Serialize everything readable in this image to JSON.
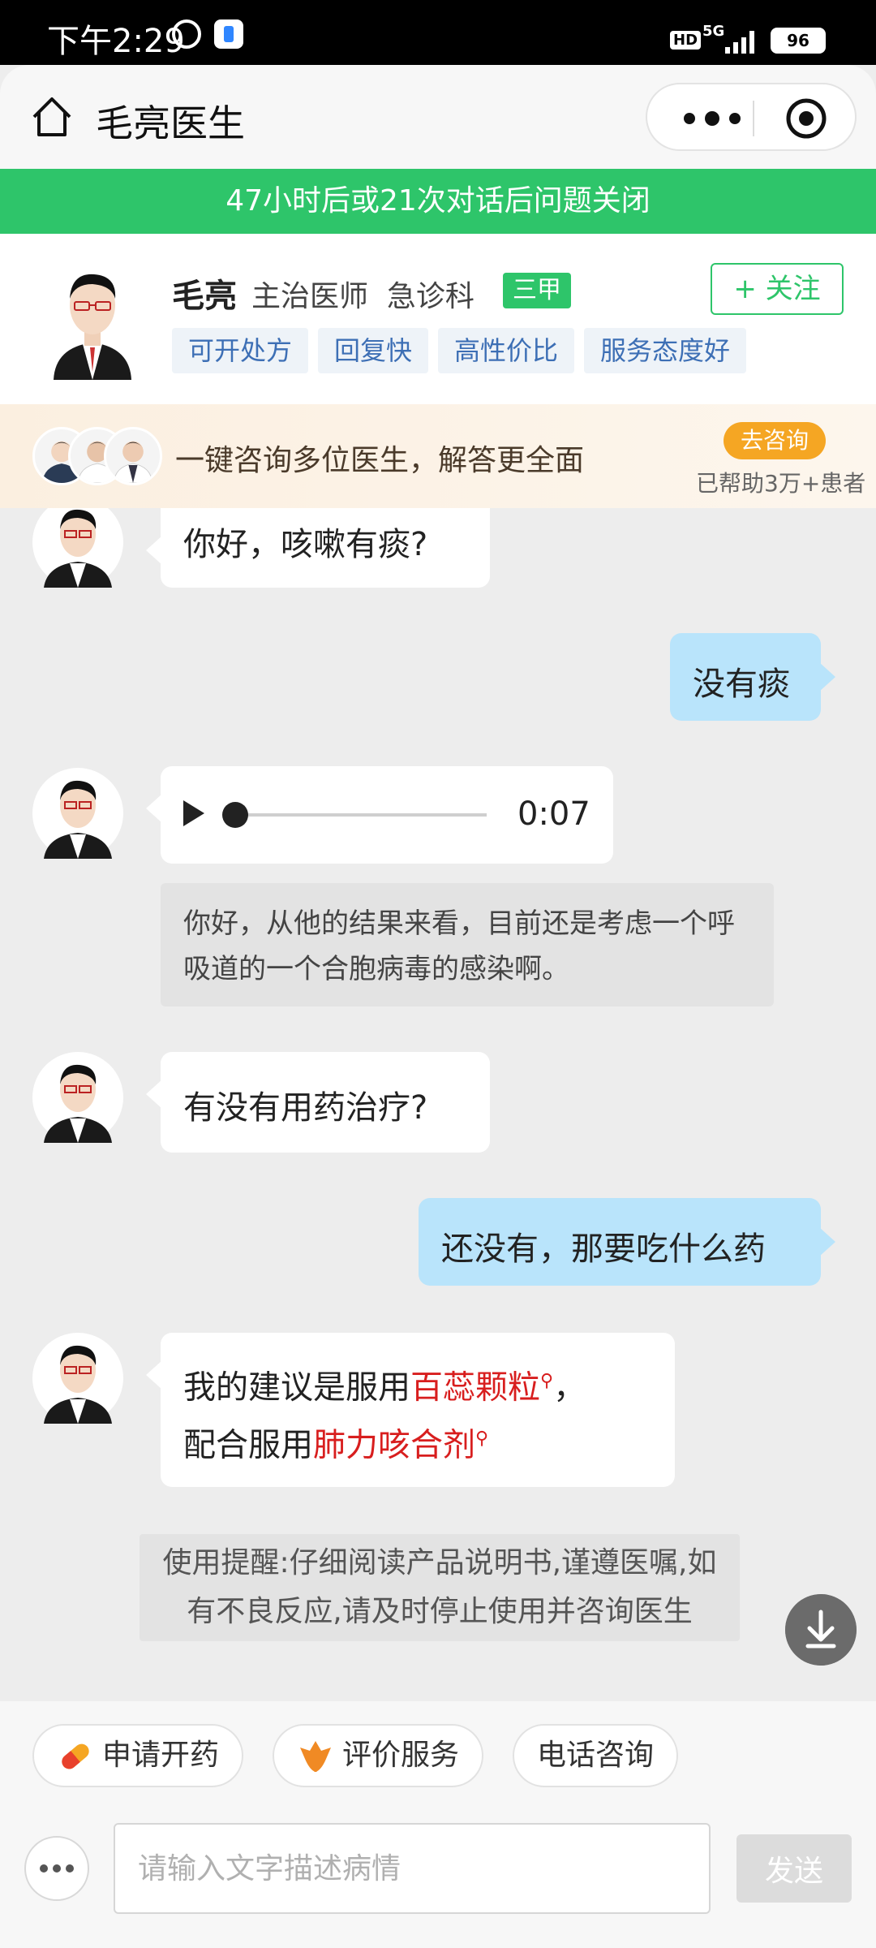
{
  "status_bar": {
    "time": "下午2:29",
    "hd": "HD",
    "network": "5G",
    "battery": "96"
  },
  "header": {
    "title": "毛亮医生"
  },
  "banner": {
    "text": "47小时后或21次对话后问题关闭"
  },
  "doctor": {
    "name": "毛亮",
    "info": "主治医师  急诊科",
    "hospital_badge": "三甲",
    "follow_label": "+ 关注",
    "tags": [
      "可开处方",
      "回复快",
      "高性价比",
      "服务态度好"
    ]
  },
  "consult_banner": {
    "text": "一键咨询多位医生，解答更全面",
    "button": "去咨询",
    "helped": "已帮助3万+患者"
  },
  "messages": {
    "m1": "你好，咳嗽有痰?",
    "m2": "没有痰",
    "voice_duration": "0:07",
    "voice_transcript": "你好，从他的结果来看，目前还是考虑一个呼吸道的一个合胞病毒的感染啊。",
    "m4": "有没有用药治疗?",
    "m5": "还没有，那要吃什么药",
    "m6_part1": "我的建议是服用",
    "m6_drug1": "百蕊颗粒",
    "m6_part2": "，",
    "m6_part3": "配合服用",
    "m6_drug2": "肺力咳合剂",
    "reminder": "使用提醒:仔细阅读产品说明书,谨遵医嘱,如有不良反应,请及时停止使用并咨询医生"
  },
  "actions": {
    "prescribe": "申请开药",
    "review": "评价服务",
    "phone": "电话咨询",
    "input_placeholder": "请输入文字描述病情",
    "send": "发送"
  },
  "colors": {
    "green": "#2ec56a",
    "orange": "#f5a623",
    "bubble_blue": "#b9e4fb",
    "drug_red": "#d81e1e"
  },
  "icons": [
    "home-icon",
    "more-icon",
    "target-icon",
    "play-icon",
    "search-icon",
    "scroll-down-icon",
    "pill-icon",
    "flower-icon"
  ]
}
